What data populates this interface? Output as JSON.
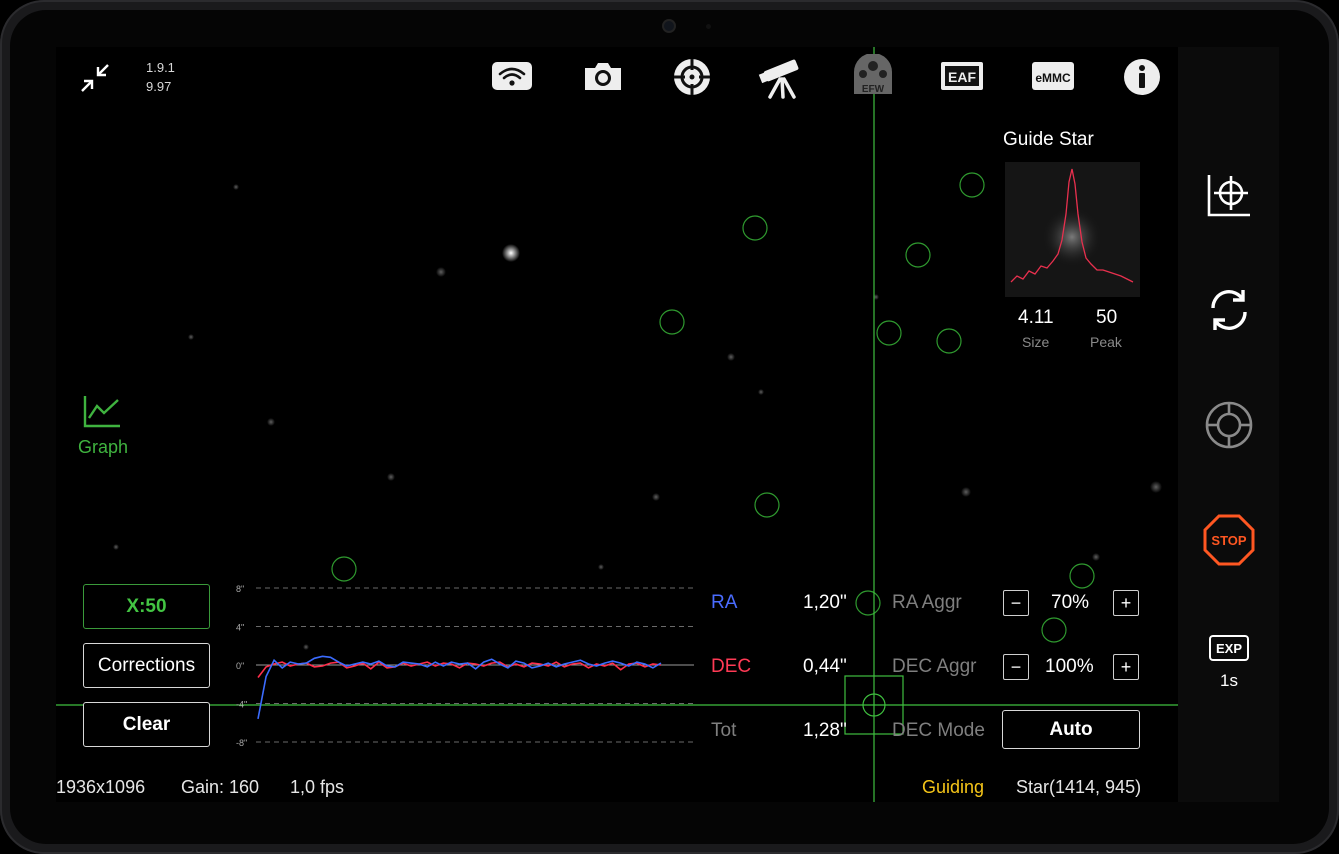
{
  "version": {
    "app": "1.9.1",
    "fw": "9.97"
  },
  "toolbar": {
    "icons": [
      "wifi-icon",
      "camera-icon",
      "target-icon",
      "telescope-icon",
      "efw-icon",
      "eaf-icon",
      "emmc-icon",
      "info-icon"
    ],
    "efw_label": "EFW",
    "eaf_label": "EAF",
    "emmc_label": "eMMC"
  },
  "guide_star": {
    "title": "Guide Star",
    "size_value": "4.11",
    "size_label": "Size",
    "peak_value": "50",
    "peak_label": "Peak"
  },
  "graph_toggle": {
    "label": "Graph"
  },
  "buttons": {
    "scale": "X:50",
    "corrections": "Corrections",
    "clear": "Clear"
  },
  "graph": {
    "y_ticks": [
      "8\"",
      "4\"",
      "0\"",
      "-4\"",
      "-8\""
    ],
    "ra_color": "#3b6cff",
    "dec_color": "#ff2d4a",
    "ra_values": [
      -5.6,
      -1.2,
      0.5,
      -0.3,
      0.3,
      0.1,
      0.2,
      0.7,
      0.9,
      0.8,
      0.3,
      -0.1,
      0.1,
      0.3,
      0.1,
      0.4,
      -0.1,
      -0.2,
      0.3,
      0.2,
      0.1,
      -0.2,
      0.3,
      -0.1,
      0.3,
      0.1,
      0.2,
      -0.4,
      0.3,
      0.6,
      0.1,
      -0.3,
      0.4,
      0.2,
      -0.3,
      -0.1,
      0.2,
      -0.2,
      0.1,
      0.3,
      0.5,
      0.1,
      -0.1,
      0.2,
      0.4,
      0.2,
      -0.1,
      0.3,
      0.1,
      -0.3,
      0.2
    ],
    "dec_values": [
      -1.3,
      -0.2,
      0.1,
      0.3,
      -0.1,
      0.1,
      0.2,
      -0.2,
      -0.1,
      0.2,
      0.3,
      -0.3,
      -0.1,
      0.2,
      -0.4,
      0.3,
      -0.3,
      -0.2,
      0.2,
      -0.1,
      0.1,
      0.3,
      -0.1,
      0.2,
      0.1,
      -0.3,
      0.2,
      0.1,
      -0.1,
      0.2,
      0.3,
      -0.2,
      0.1,
      -0.2,
      0.2,
      0.1,
      -0.1,
      0.3,
      -0.2,
      0.1,
      0.2,
      -0.3,
      0.1,
      -0.1,
      0.2,
      -0.5,
      0.1,
      0.2,
      -0.2,
      0.1,
      0.0
    ],
    "y_range": [
      -8,
      8
    ]
  },
  "stats": {
    "ra_label": "RA",
    "ra_value": "1,20\"",
    "dec_label": "DEC",
    "dec_value": "0,44\"",
    "tot_label": "Tot",
    "tot_value": "1,28\""
  },
  "settings": {
    "ra_aggr_label": "RA Aggr",
    "ra_aggr_value": "70%",
    "dec_aggr_label": "DEC Aggr",
    "dec_aggr_value": "100%",
    "dec_mode_label": "DEC Mode",
    "dec_mode_value": "Auto",
    "minus": "−",
    "plus": "+"
  },
  "sidebar": {
    "icons": [
      "graph-target-icon",
      "refresh-icon",
      "crosshair-icon",
      "stop-icon",
      "exp-icon"
    ],
    "stop_label": "STOP",
    "exp_label": "EXP",
    "exp_value": "1s"
  },
  "status": {
    "resolution": "1936x1096",
    "gain": "Gain: 160",
    "fps": "1,0 fps",
    "state": "Guiding",
    "state_color": "#f5c518",
    "star": "Star(1414, 945)"
  }
}
